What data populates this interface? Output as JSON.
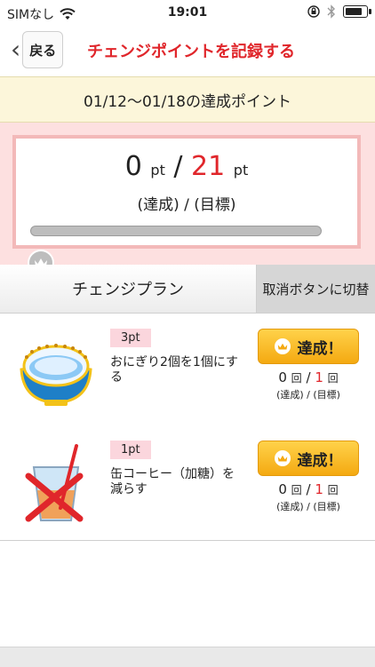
{
  "status": {
    "carrier": "SIMなし",
    "time": "19:01"
  },
  "nav": {
    "back_label": "戻る",
    "title": "チェンジポイントを記録する"
  },
  "period_text": "01/12〜01/18の達成ポイント",
  "points": {
    "achieved": "0",
    "target": "21",
    "unit": "pt",
    "separator": "/",
    "caption": "(達成) / (目標)",
    "progress_fraction": 0
  },
  "tabs": {
    "plan": "チェンジプラン",
    "cancel": "取消ボタンに切替"
  },
  "items": [
    {
      "pt": "3pt",
      "desc": "おにぎり2個を1個にする",
      "button": "達成！",
      "achieved": "0",
      "target": "1",
      "unit": "回",
      "caption": "(達成) / (目標)",
      "icon": "rice-bowl-icon"
    },
    {
      "pt": "1pt",
      "desc": "缶コーヒー（加糖）を減らす",
      "button": "達成！",
      "achieved": "0",
      "target": "1",
      "unit": "回",
      "caption": "(達成) / (目標)",
      "icon": "no-sweet-drink-icon"
    }
  ],
  "colors": {
    "accent": "#e0262b",
    "button": "#f4a911",
    "period_bg": "#fcf6da",
    "points_bg": "#fde0e0"
  }
}
